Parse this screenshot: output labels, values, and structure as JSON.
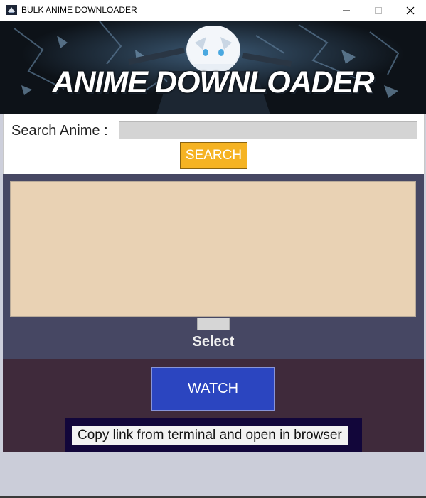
{
  "window": {
    "title": "BULK ANIME DOWNLOADER",
    "controls": {
      "minimize_icon": "minimize-icon",
      "maximize_icon": "maximize-icon",
      "close_icon": "close-icon"
    }
  },
  "banner": {
    "title": "ANIME DOWNLOADER"
  },
  "search": {
    "label": "Search Anime :",
    "value": "",
    "button_label": "SEARCH"
  },
  "results": {
    "items": [],
    "select_label": "Select"
  },
  "watch": {
    "button_label": "WATCH",
    "hint": "Copy link from terminal and open in browser"
  },
  "colors": {
    "search_button": "#f5b323",
    "watch_button": "#2b45c0",
    "results_bg": "#e9d2b4",
    "results_section": "#464763",
    "watch_section": "#3f2a3b",
    "hint_box": "#12063a"
  }
}
